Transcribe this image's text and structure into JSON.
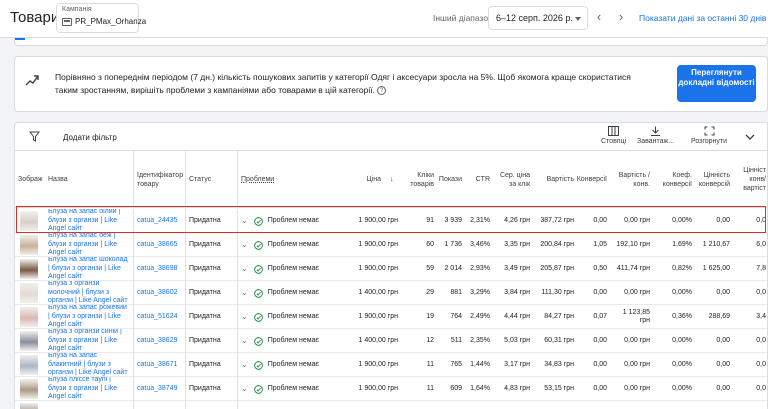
{
  "header": {
    "title": "Товари",
    "campaign_label": "Кампанія",
    "campaign_value": "PR_PMax_Orhanza",
    "range_label": "Інший діапазон",
    "date_range": "6–12 серп. 2026 р.",
    "show_last": "Показати дані за останні 30 днів"
  },
  "insight": {
    "text": "Порівняно з попереднім періодом (7 дн.) кількість пошукових запитів у категорії Одяг і аксесуари зросла на 5%. Щоб якомога краще скористатися таким зростанням, вирішіть проблеми з кампаніями або товарами в цій категорії.",
    "button": "Переглянути докладні відомості"
  },
  "toolbar": {
    "add_filter": "Додати фільтр",
    "columns": "Стовпці",
    "download": "Завантаж...",
    "expand": "Розгорнути"
  },
  "columns": {
    "image": "Зображ",
    "name": "Назва",
    "id": "Ідентифікатор товару",
    "status": "Статус",
    "issues": "Проблеми",
    "price": "Ціна",
    "clicks": "Кліки товарів",
    "impressions": "Покази",
    "ctr": "CTR",
    "cpc": "Сер. ціна за клік",
    "cost": "Вартість",
    "conversions": "Конверсії",
    "cost_conv": "Вартість / конв.",
    "conv_rate": "Коеф. конверсії",
    "conv_value": "Цінність конверсій",
    "value_cost": "Цінніст конв/ вартіст"
  },
  "rows": [
    {
      "name": "Блуза на запас білий | блузи з органзи | Like Angel сайт",
      "id": "catua_24435",
      "status": "Придатна",
      "issues": "Проблем немає",
      "price": "1 900,00 грн",
      "clicks": "91",
      "impressions": "3 939",
      "ctr": "2,31%",
      "cpc": "4,26 грн",
      "cost": "387,72 грн",
      "conversions": "0,00",
      "cost_conv": "0,00 грн",
      "conv_rate": "0,00%",
      "conv_value": "0,00",
      "value_cost": "0,0",
      "thumb": "#d9cfc6"
    },
    {
      "name": "Блуза на запас беж | блузи з органзи | Like Angel сайт",
      "id": "catua_38665",
      "status": "Придатна",
      "issues": "Проблем немає",
      "price": "1 900,00 грн",
      "clicks": "60",
      "impressions": "1 736",
      "ctr": "3,46%",
      "cpc": "3,35 грн",
      "cost": "200,84 грн",
      "conversions": "1,05",
      "cost_conv": "192,10 грн",
      "conv_rate": "1,69%",
      "conv_value": "1 210,67",
      "value_cost": "6,0",
      "thumb": "#c7b29a"
    },
    {
      "name": "Блуза на запас шоколад | блузи з органзи | Like Angel сайт",
      "id": "catua_38698",
      "status": "Придатна",
      "issues": "Проблем немає",
      "price": "1 900,00 грн",
      "clicks": "59",
      "impressions": "2 014",
      "ctr": "2,93%",
      "cpc": "3,49 грн",
      "cost": "205,87 грн",
      "conversions": "0,50",
      "cost_conv": "411,74 грн",
      "conv_rate": "0,82%",
      "conv_value": "1 625,00",
      "value_cost": "7,8",
      "thumb": "#7a5a48"
    },
    {
      "name": "Блуза з органзи молочний | блузи з органзи | Like Angel сайт",
      "id": "catua_38602",
      "status": "Придатна",
      "issues": "Проблем немає",
      "price": "1 400,00 грн",
      "clicks": "29",
      "impressions": "881",
      "ctr": "3,29%",
      "cpc": "3,84 грн",
      "cost": "111,30 грн",
      "conversions": "0,00",
      "cost_conv": "0,00 грн",
      "conv_rate": "0,00%",
      "conv_value": "0,00",
      "value_cost": "0,0",
      "thumb": "#e3dcd2"
    },
    {
      "name": "Блуза на запас рожевий | блузи з органзи | Like Angel сайт",
      "id": "catua_51624",
      "status": "Придатна",
      "issues": "Проблем немає",
      "price": "1 900,00 грн",
      "clicks": "19",
      "impressions": "764",
      "ctr": "2,49%",
      "cpc": "4,44 грн",
      "cost": "84,27 грн",
      "conversions": "0,07",
      "cost_conv": "1 123,85 грн",
      "conv_rate": "0,36%",
      "conv_value": "288,69",
      "value_cost": "3,4",
      "thumb": "#d8b9b4"
    },
    {
      "name": "Блуза з органзи синій | блузи з органзи | Like Angel сайт",
      "id": "catua_38629",
      "status": "Придатна",
      "issues": "Проблем немає",
      "price": "1 400,00 грн",
      "clicks": "12",
      "impressions": "511",
      "ctr": "2,35%",
      "cpc": "5,03 грн",
      "cost": "60,31 грн",
      "conversions": "0,00",
      "cost_conv": "0,00 грн",
      "conv_rate": "0,00%",
      "conv_value": "0,00",
      "value_cost": "0,0",
      "thumb": "#8a8f9e"
    },
    {
      "name": "Блуза на запас блакитний | блузи з органзи | Like Angel сайт",
      "id": "catua_38671",
      "status": "Придатна",
      "issues": "Проблем немає",
      "price": "1 900,00 грн",
      "clicks": "11",
      "impressions": "765",
      "ctr": "1,44%",
      "cpc": "3,17 грн",
      "cost": "34,83 грн",
      "conversions": "0,00",
      "cost_conv": "0,00 грн",
      "conv_rate": "0,00%",
      "conv_value": "0,00",
      "value_cost": "0,0",
      "thumb": "#a9b7c6"
    },
    {
      "name": "Блуза пліссе таупі | блузи з органзи | Like Angel сайт",
      "id": "catua_38749",
      "status": "Придатна",
      "issues": "Проблем немає",
      "price": "1 900,00 грн",
      "clicks": "11",
      "impressions": "609",
      "ctr": "1,64%",
      "cpc": "4,83 грн",
      "cost": "53,15 грн",
      "conversions": "0,00",
      "cost_conv": "0,00 грн",
      "conv_rate": "0,00%",
      "conv_value": "0,00",
      "value_cost": "0,0",
      "thumb": "#a99b8a"
    },
    {
      "name": "",
      "id": "",
      "status": "",
      "issues": "",
      "price": "",
      "clicks": "",
      "impressions": "",
      "ctr": "",
      "cpc": "",
      "cost": "",
      "conversions": "",
      "cost_conv": "",
      "conv_rate": "",
      "conv_value": "",
      "value_cost": "",
      "thumb": "#9a8f88"
    }
  ]
}
